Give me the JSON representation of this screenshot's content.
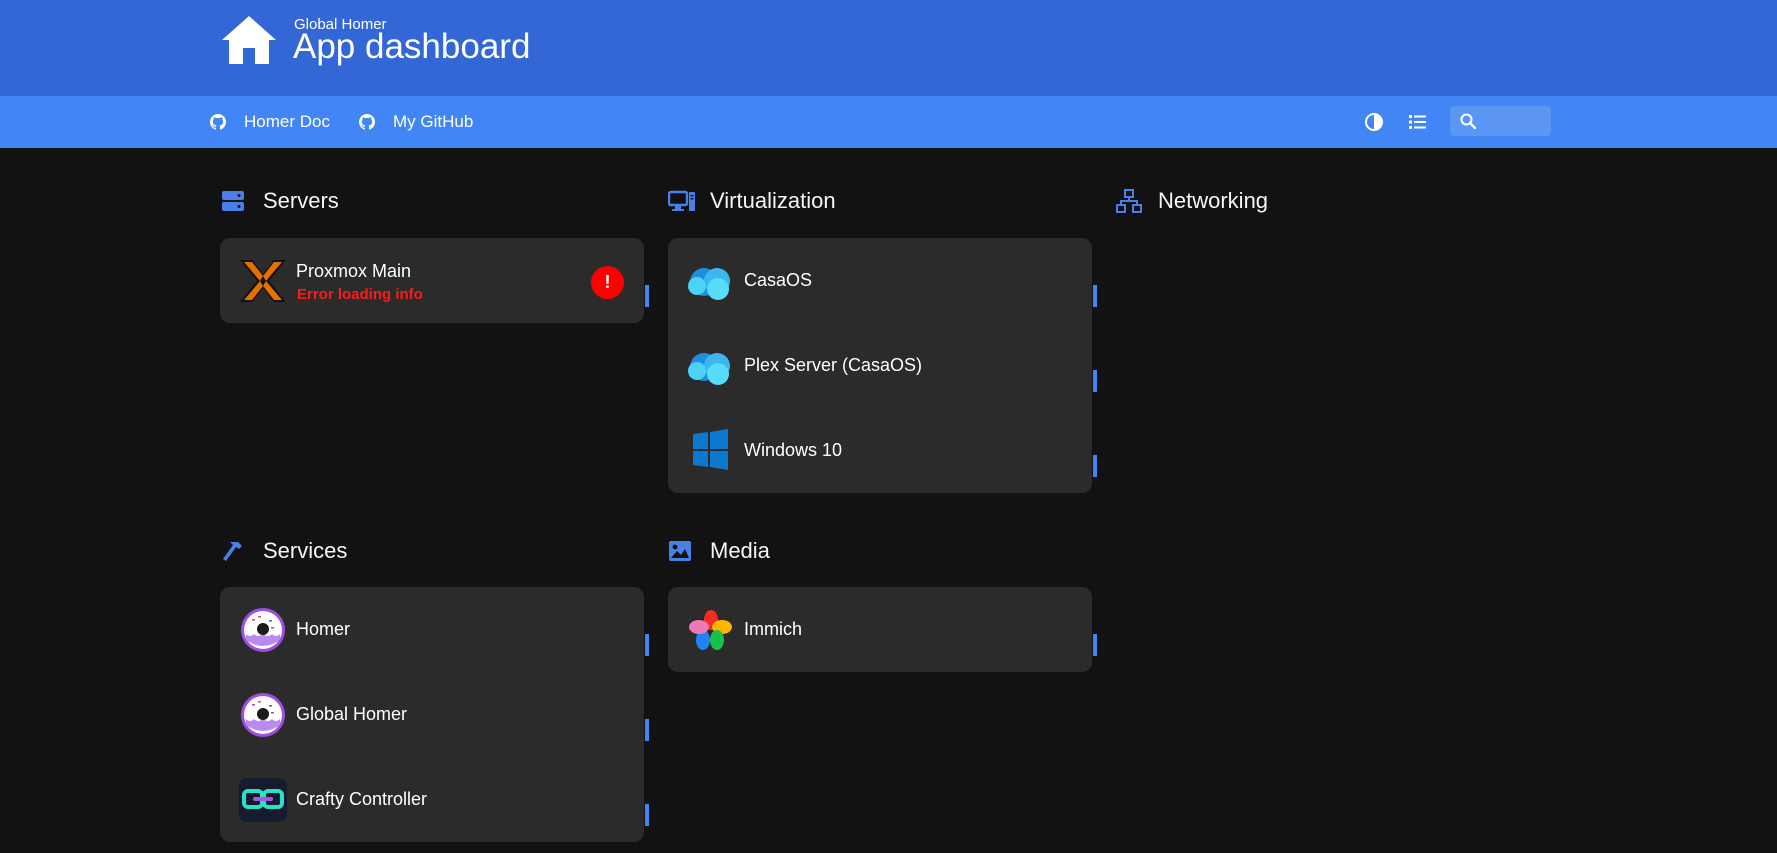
{
  "header": {
    "subtitle": "Global Homer",
    "title": "App dashboard",
    "logo_icon": "home-icon"
  },
  "nav": {
    "links": [
      {
        "label": "Homer Doc",
        "icon": "github-icon"
      },
      {
        "label": "My GitHub",
        "icon": "github-icon"
      }
    ],
    "theme_icon": "contrast-icon",
    "layout_icon": "list-icon",
    "search": {
      "placeholder": "",
      "value": "",
      "icon": "search-icon"
    }
  },
  "groups": {
    "servers": {
      "title": "Servers",
      "icon": "server-icon",
      "items": [
        {
          "name": "Proxmox Main",
          "status": "Error loading info",
          "icon": "proxmox-icon",
          "alert": "!"
        }
      ]
    },
    "virtualization": {
      "title": "Virtualization",
      "icon": "desktop-icon",
      "items": [
        {
          "name": "CasaOS",
          "icon": "casaos-icon"
        },
        {
          "name": "Plex Server (CasaOS)",
          "icon": "casaos-icon"
        },
        {
          "name": "Windows 10",
          "icon": "windows-icon"
        }
      ]
    },
    "networking": {
      "title": "Networking",
      "icon": "network-icon",
      "items": []
    },
    "services": {
      "title": "Services",
      "icon": "hammer-icon",
      "items": [
        {
          "name": "Homer",
          "icon": "homer-donut-icon"
        },
        {
          "name": "Global Homer",
          "icon": "homer-donut-icon"
        },
        {
          "name": "Crafty Controller",
          "icon": "crafty-icon"
        }
      ]
    },
    "media": {
      "title": "Media",
      "icon": "image-icon",
      "items": [
        {
          "name": "Immich",
          "icon": "immich-icon"
        }
      ]
    }
  },
  "colors": {
    "header": "#3367d6",
    "navbar": "#4285f4",
    "background": "#121212",
    "card": "#2b2b2b",
    "accent": "#4285f4",
    "error": "#ff1a1a"
  }
}
